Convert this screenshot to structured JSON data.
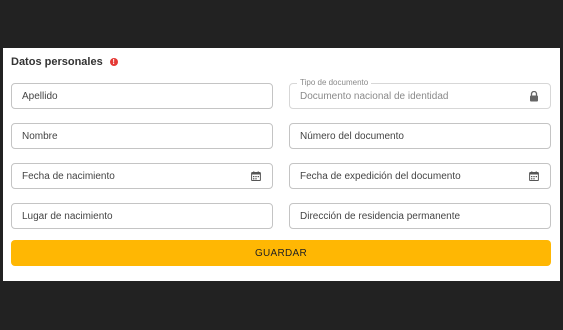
{
  "form": {
    "section_title": "Datos personales",
    "alert_icon": "!",
    "fields": {
      "apellido": {
        "placeholder": "Apellido"
      },
      "tipo_documento": {
        "label": "Tipo de documento",
        "value": "Documento nacional de identidad",
        "icon": "lock-icon",
        "disabled": true
      },
      "nombre": {
        "placeholder": "Nombre"
      },
      "numero_documento": {
        "placeholder": "Número del documento"
      },
      "fecha_nacimiento": {
        "placeholder": "Fecha de nacimiento",
        "icon": "calendar-icon"
      },
      "fecha_expedicion": {
        "placeholder": "Fecha de expedición del documento",
        "icon": "calendar-icon"
      },
      "lugar_nacimiento": {
        "placeholder": "Lugar de nacimiento"
      },
      "direccion_residencia": {
        "placeholder": "Dirección de residencia permanente"
      }
    },
    "save_label": "GUARDAR"
  },
  "colors": {
    "background": "#222222",
    "card": "#ffffff",
    "accent": "#ffb703",
    "alert": "#e53935"
  }
}
